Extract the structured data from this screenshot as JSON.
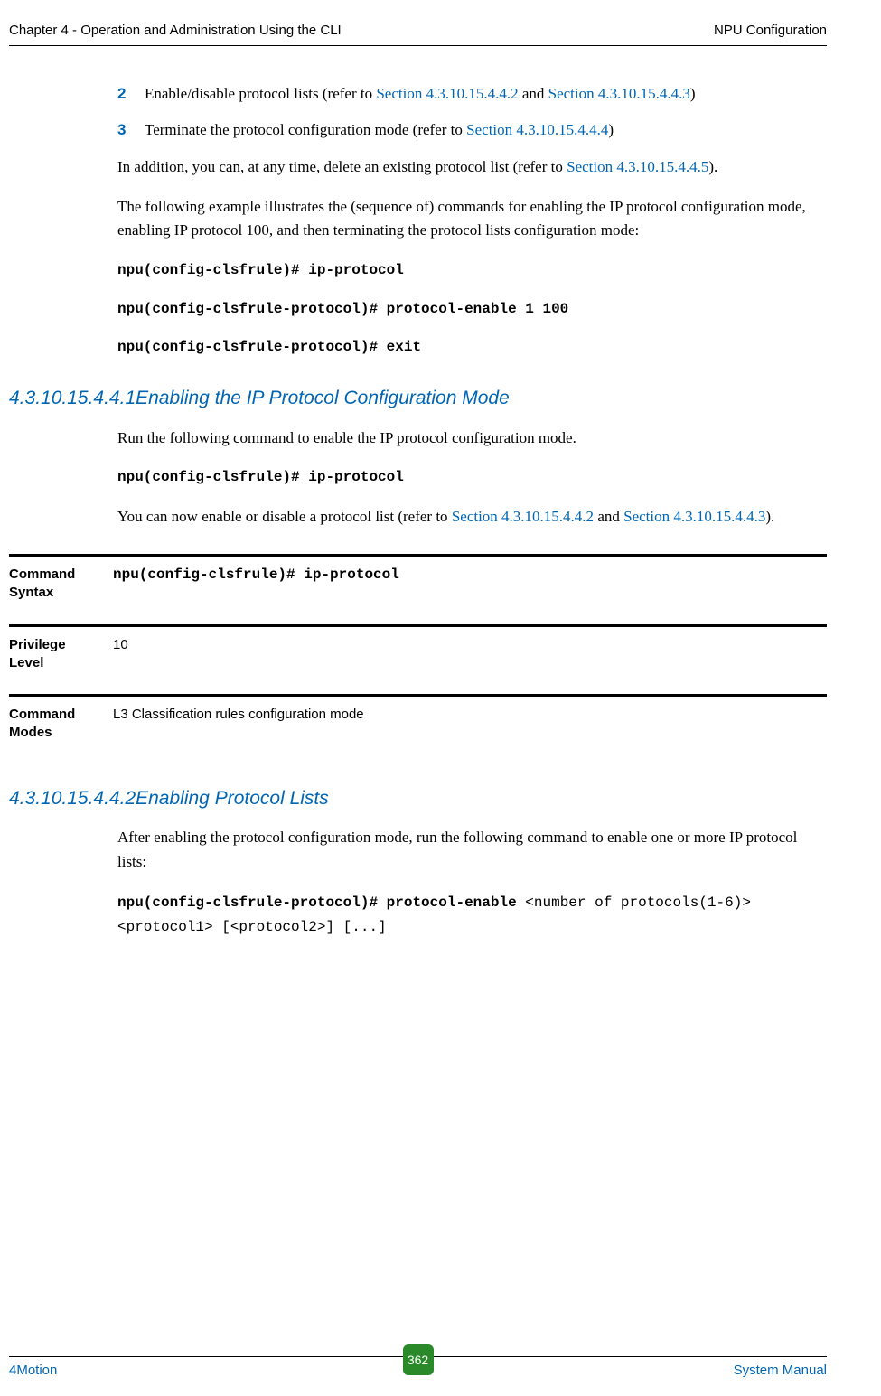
{
  "header": {
    "left": "Chapter 4 - Operation and Administration Using the CLI",
    "right": "NPU Configuration"
  },
  "intro": {
    "item2": {
      "num": "2",
      "text_a": "Enable/disable protocol lists (refer to ",
      "link_a": "Section 4.3.10.15.4.4.2",
      "text_b": " and ",
      "link_b": "Section 4.3.10.15.4.4.3",
      "text_c": ")"
    },
    "item3": {
      "num": "3",
      "text_a": "Terminate the protocol configuration mode (refer to ",
      "link_a": "Section 4.3.10.15.4.4.4",
      "text_b": ")"
    },
    "p1_a": "In addition, you can, at any time, delete an existing protocol list (refer to ",
    "p1_link": "Section 4.3.10.15.4.4.5",
    "p1_b": ").",
    "p2": "The following example illustrates the (sequence of) commands for enabling the IP protocol configuration mode, enabling IP protocol 100, and then terminating the protocol lists configuration mode:",
    "cmd1": "npu(config-clsfrule)# ip-protocol",
    "cmd2": "npu(config-clsfrule-protocol)# protocol-enable 1 100",
    "cmd3": "npu(config-clsfrule-protocol)# exit"
  },
  "sec1": {
    "num": "4.3.10.15.4.4.1",
    "title": "Enabling the IP Protocol Configuration Mode",
    "p1": "Run the following command to enable the IP protocol configuration mode.",
    "cmd": "npu(config-clsfrule)# ip-protocol",
    "p2_a": "You can now enable or disable a protocol list (refer to ",
    "p2_link1": "Section 4.3.10.15.4.4.2",
    "p2_b": " and ",
    "p2_link2": "Section 4.3.10.15.4.4.3",
    "p2_c": ").",
    "table": {
      "row1_label": "Command Syntax",
      "row1_value": "npu(config-clsfrule)# ip-protocol",
      "row2_label": "Privilege Level",
      "row2_value": "10",
      "row3_label": "Command Modes",
      "row3_value": "L3 Classification rules configuration mode"
    }
  },
  "sec2": {
    "num": "4.3.10.15.4.4.2",
    "title": "Enabling Protocol Lists",
    "p1": "After enabling the protocol configuration mode, run the following command to enable one or more IP protocol lists:",
    "cmd_bold": "npu(config-clsfrule-protocol)# protocol-enable ",
    "cmd_plain": "<number of protocols(1-6)> <protocol1> [<protocol2>] [...]"
  },
  "footer": {
    "left": "4Motion",
    "page": "362",
    "right": "System Manual"
  }
}
